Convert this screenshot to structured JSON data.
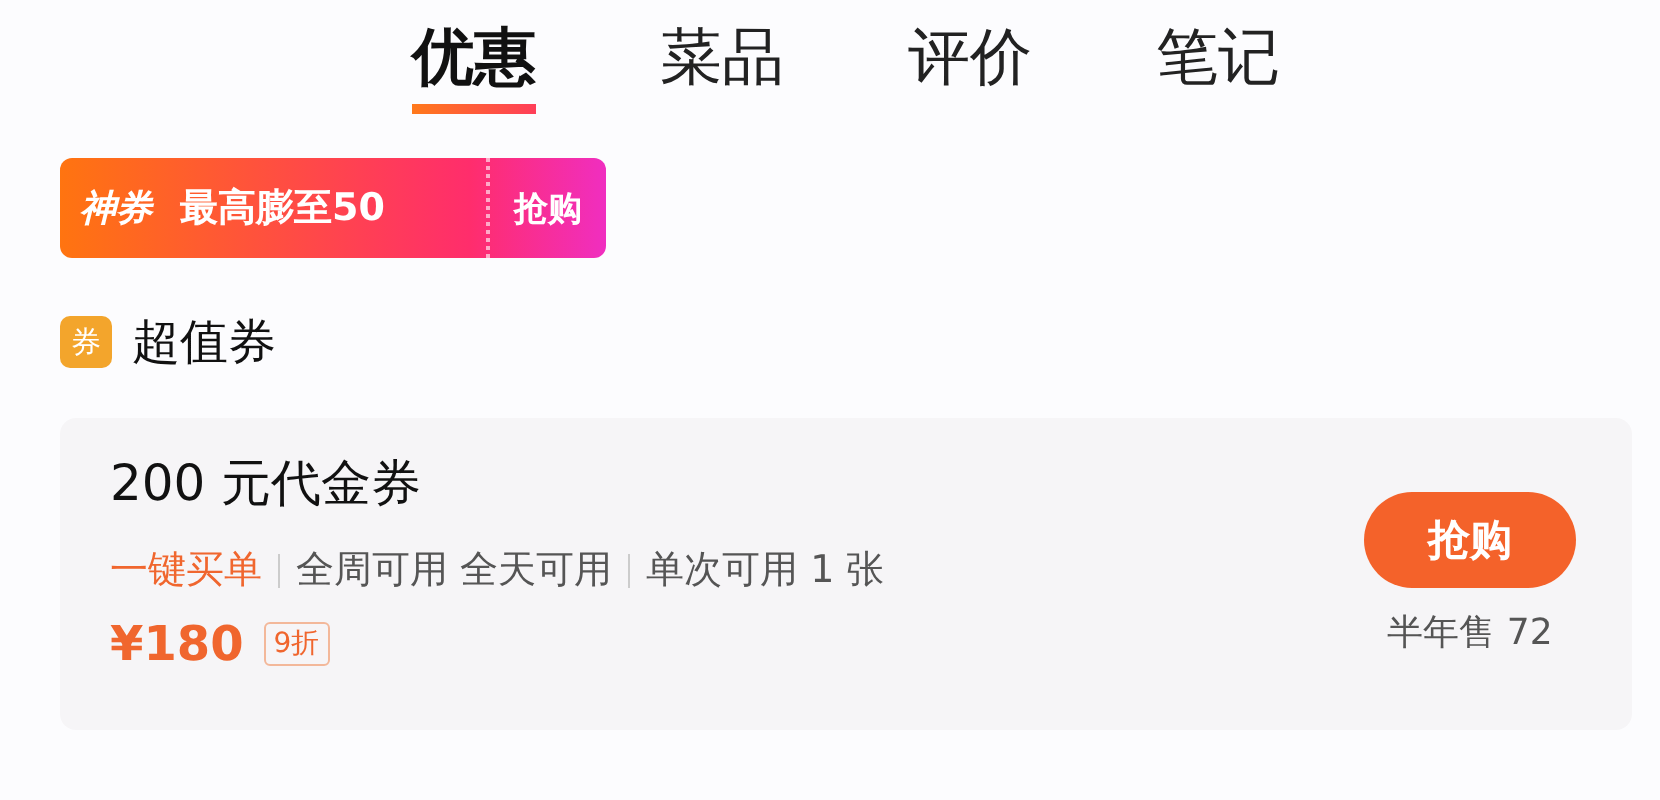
{
  "tabs": [
    {
      "label": "优惠",
      "selected": true
    },
    {
      "label": "菜品",
      "selected": false
    },
    {
      "label": "评价",
      "selected": false
    },
    {
      "label": "笔记",
      "selected": false
    }
  ],
  "promo_banner": {
    "tag": "神券",
    "text": "最高膨至50",
    "action": "抢购"
  },
  "section": {
    "icon_text": "券",
    "title": "超值券"
  },
  "voucher": {
    "title": "200 元代金券",
    "features": [
      {
        "text": "一键买单",
        "kind": "accent"
      },
      {
        "text": "全周可用 全天可用",
        "kind": "plain"
      },
      {
        "text": "单次可用 1 张",
        "kind": "plain"
      }
    ],
    "price": "¥180",
    "discount": "9折",
    "button": "抢购",
    "sales": "半年售 72"
  }
}
